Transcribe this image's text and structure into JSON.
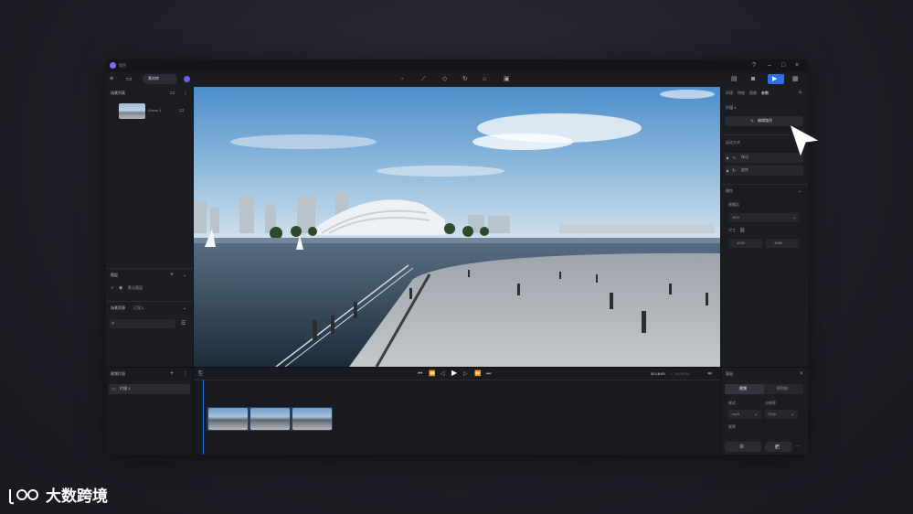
{
  "app": {
    "title": "项目",
    "library_button": "素材库"
  },
  "window_controls": [
    "help-icon",
    "minimize-icon",
    "maximize-icon",
    "close-icon"
  ],
  "toolbar_center_icons": [
    "light-icon",
    "measure-icon",
    "shape-icon",
    "rotate-icon",
    "camera-move-icon",
    "image-icon"
  ],
  "left_panel": {
    "scene_list_title": "场景列表",
    "scene_item": "Scene 1",
    "layers_title": "图层",
    "default_layer": "默认图层",
    "assets_tab_1": "场景资源",
    "assets_tab_2": "已导入",
    "search_placeholder": ""
  },
  "right_panel": {
    "tabs": [
      "环境",
      "特效",
      "图像",
      "参数"
    ],
    "active_tab_index": 3,
    "shot_label": "片段 1",
    "edit_path_button": "编辑路径",
    "motion_section": "运动方式",
    "motion_items": [
      "移动",
      "旋转"
    ],
    "properties_section": "属性",
    "aspect_label": "画幅比",
    "aspect_value": "16:9",
    "size_label": "尺寸",
    "width": "1920",
    "height": "1080"
  },
  "bottom_left": {
    "title": "视频片段",
    "clip_item": "片段 1"
  },
  "timeline": {
    "current_time": "00:18:00",
    "total_time": "00:30:00",
    "separator": "/",
    "thumbnails_count": 3
  },
  "render_panel": {
    "title": "导出",
    "tabs": [
      "视频",
      "序列帧"
    ],
    "active_tab_index": 0,
    "format_label": "格式",
    "format_value": ".mp4",
    "resolution_label": "分辨率",
    "resolution_value": "720p",
    "fps_label": "帧率",
    "more": "···"
  },
  "watermark": {
    "text": "大数跨境"
  },
  "colors": {
    "accent": "#2f6fe6",
    "background": "#201f27",
    "panel": "#1c1d22"
  }
}
